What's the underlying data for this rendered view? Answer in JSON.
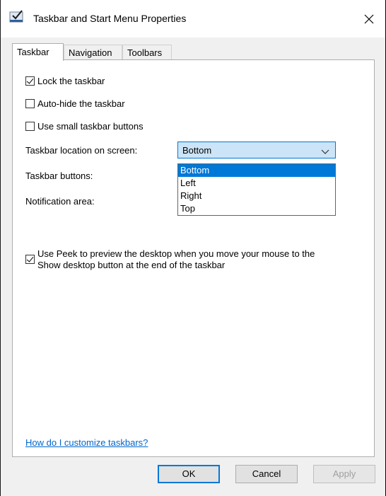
{
  "window": {
    "title": "Taskbar and Start Menu Properties",
    "close_glyph": "✕"
  },
  "tabs": [
    {
      "label": "Taskbar",
      "active": true
    },
    {
      "label": "Navigation",
      "active": false
    },
    {
      "label": "Toolbars",
      "active": false
    }
  ],
  "taskbar": {
    "lock": {
      "label": "Lock the taskbar",
      "checked": true
    },
    "autohide": {
      "label": "Auto-hide the taskbar",
      "checked": false
    },
    "small_buttons": {
      "label": "Use small taskbar buttons",
      "checked": false
    },
    "location_label": "Taskbar location on screen:",
    "location_value": "Bottom",
    "location_options": [
      "Bottom",
      "Left",
      "Right",
      "Top"
    ],
    "buttons_label": "Taskbar buttons:",
    "notification_label": "Notification area:",
    "peek": {
      "line1": "Use Peek to preview the desktop when you move your mouse to the",
      "line2": "Show desktop button at the end of the taskbar",
      "checked": true
    },
    "help_link": "How do I customize taskbars?"
  },
  "buttons": {
    "ok": "OK",
    "cancel": "Cancel",
    "apply": "Apply"
  },
  "colors": {
    "accent": "#0078d7",
    "selection": "#cce4f7",
    "link": "#0066cc"
  }
}
